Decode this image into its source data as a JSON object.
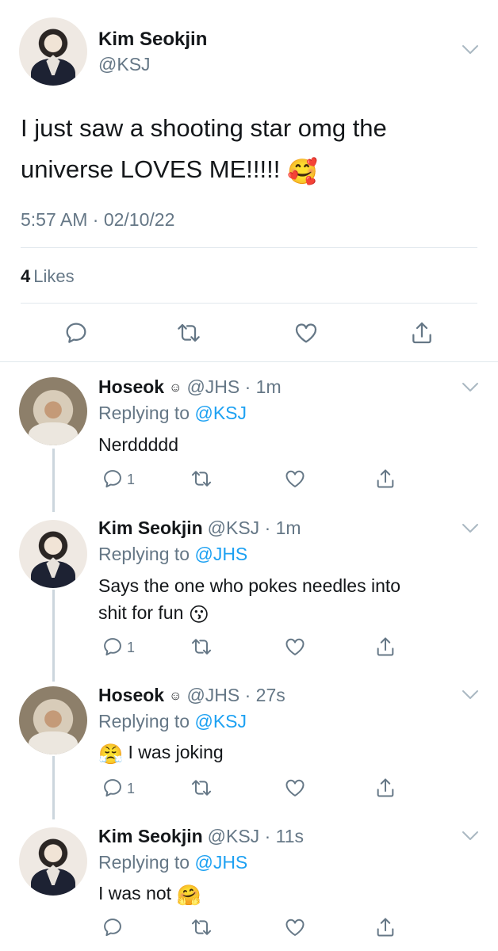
{
  "main_tweet": {
    "author_name": "Kim Seokjin",
    "author_handle": "@KSJ",
    "text_line1": "I just saw a shooting star omg the",
    "text_line2": "universe LOVES ME!!!!!",
    "emoji": "🥰",
    "timestamp": "5:57 AM · 02/10/22",
    "likes_count": "4",
    "likes_label": "Likes"
  },
  "replies": [
    {
      "author_name": "Hoseok",
      "badge": "☺",
      "meta": "@JHS · 1m",
      "replying_prefix": "Replying to",
      "replying_to": "@KSJ",
      "text": "Nerddddd",
      "reply_count": "1"
    },
    {
      "author_name": "Kim Seokjin",
      "meta": "@KSJ · 1m",
      "replying_prefix": "Replying to",
      "replying_to": "@JHS",
      "text_line1": "Says the one who pokes needles into",
      "text_line2": "shit for fun",
      "emoji": "😗",
      "reply_count": "1"
    },
    {
      "author_name": "Hoseok",
      "badge": "☺",
      "meta": "@JHS · 27s",
      "replying_prefix": "Replying to",
      "replying_to": "@KSJ",
      "emoji": "😤",
      "text": "I was joking",
      "reply_count": "1"
    },
    {
      "author_name": "Kim Seokjin",
      "meta": "@KSJ · 11s",
      "replying_prefix": "Replying to",
      "replying_to": "@JHS",
      "text": "I was not",
      "emoji": "🤗"
    }
  ],
  "icons": {
    "reply": "reply-icon",
    "retweet": "retweet-icon",
    "like": "heart-icon",
    "share": "share-icon",
    "menu": "chevron-down-icon"
  },
  "colors": {
    "link": "#1da1f2",
    "secondary_text": "#657786",
    "icon": "#657786",
    "divider": "#e1e8ed"
  }
}
